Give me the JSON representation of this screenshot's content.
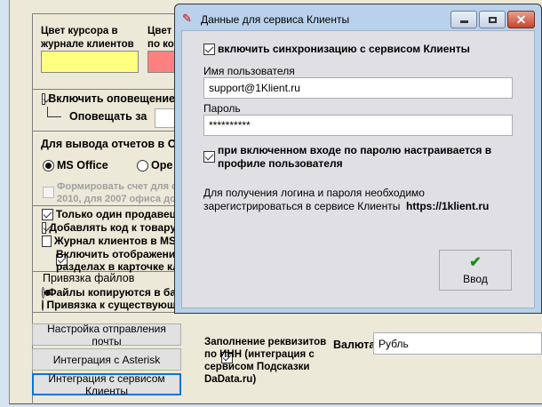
{
  "bg": {
    "cursor_color_label": "Цвет курсора в журнале клиентов",
    "color2_label_line1": "Цвет",
    "color2_label_line2": "по ко",
    "notify_check": "Включить оповещение",
    "notify_for": "Оповещать за",
    "office_title": "Для вывода отчетов в Of",
    "radio_ms": "MS Office",
    "radio_open": "Ope",
    "invoice_line1": "Формировать счет для о",
    "invoice_line2": "2010, для 2007 офиса до",
    "checks": [
      "Только один продавец",
      "Добавлять код к товару",
      "Журнал клиентов в MS",
      "Включить отображение",
      "разделах в карточке кл"
    ],
    "files_title": "Привязка файлов",
    "files_radio1": "Файлы копируются в ба",
    "files_radio2": "Привязка к существующ",
    "btn_mail": "Настройка отправления почты",
    "btn_asterisk": "Интеграция с Asterisk",
    "btn_clients": "Интеграция с сервисом Клиенты",
    "inn_check": "Заполнение реквизитов по ИНН (интеграция с сервисом Подсказки DaData.ru)",
    "currency_label": "Валюта",
    "currency_value": "Рубль",
    "colors": {
      "yellow": "#ffff80",
      "red": "#ff8080"
    }
  },
  "dialog": {
    "title": "Данные для сервиса Клиенты",
    "sync_check": "включить синхронизацию с сервисом Клиенты",
    "user_label": "Имя пользователя",
    "user_value": "support@1Klient.ru",
    "pass_label": "Пароль",
    "pass_value": "**********",
    "profile_check": "при включенном входе по паролю настраивается в профиле пользователя",
    "info_text": "Для получения логина и пароля необходимо зарегистрироваться в сервисе Клиенты",
    "info_link": "https://1klient.ru",
    "ok_label": "Ввод"
  }
}
